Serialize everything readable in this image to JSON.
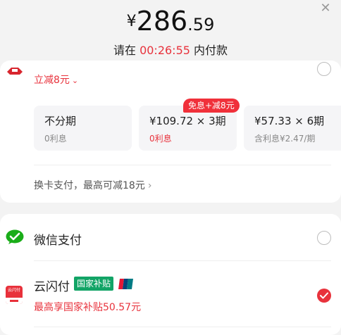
{
  "header": {
    "close_icon": "close-icon",
    "amount": {
      "currency": "¥",
      "integer": "286",
      "decimal": ".59"
    },
    "pay_before": {
      "prefix": "请在 ",
      "time": "00:26:55",
      "suffix": " 内付款"
    }
  },
  "bank_card": {
    "logo_icon": "bank-logo-icon",
    "discount": "立减8元",
    "chevron_icon": "chevron-down-icon",
    "plans": [
      {
        "title": "不分期",
        "sub": "0利息"
      },
      {
        "title": "¥109.72 × 3期",
        "sub": "0利息",
        "badge": "免息+减8元"
      },
      {
        "title": "¥57.33 × 6期",
        "sub": "含利息¥2.47/期"
      }
    ],
    "switch_card": "换卡支付，最高可减18元",
    "arrow_icon": "chevron-right-icon"
  },
  "wechat_pay": {
    "label": "微信支付",
    "icon": "wechat-icon"
  },
  "union_pay": {
    "label": "云闪付",
    "tag": "国家补贴",
    "icon_text": "云闪付",
    "subsidy": "最高享国家补贴50.57元",
    "selected": true
  },
  "colors": {
    "accent": "#e8323c",
    "wechat_green": "#1aad19",
    "tag_green": "#12a466"
  }
}
